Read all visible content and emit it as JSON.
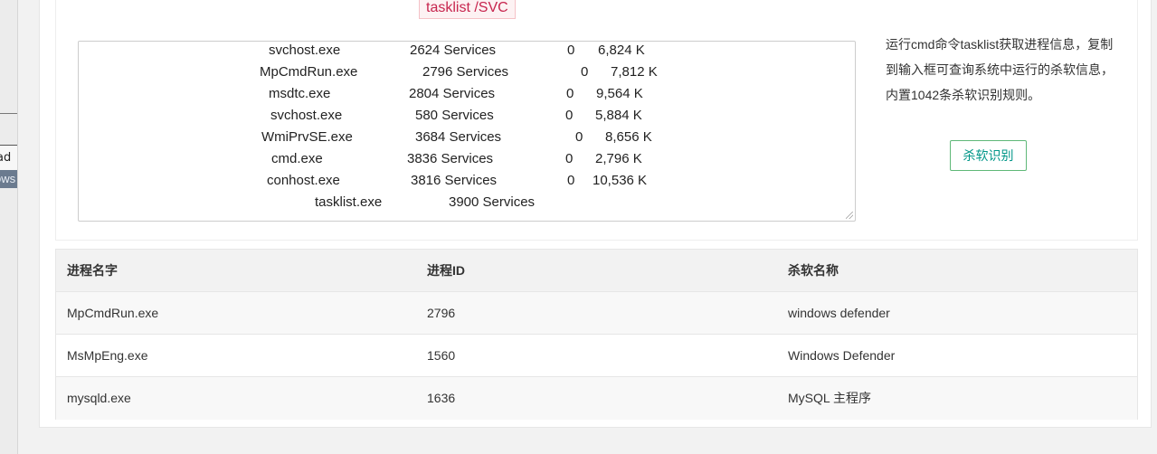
{
  "background_window": {
    "fragment_line1": "ad",
    "fragment_line2": "ows"
  },
  "command": "tasklist /SVC",
  "textarea_lines": [
    {
      "name": "svchost.exe",
      "pid": "2624 Services",
      "session": "0",
      "mem": "6,824 K"
    },
    {
      "name": "MpCmdRun.exe",
      "pid": "2796 Services",
      "session": "0",
      "mem": "7,812 K"
    },
    {
      "name": "msdtc.exe",
      "pid": "2804 Services",
      "session": "0",
      "mem": "9,564 K"
    },
    {
      "name": "svchost.exe",
      "pid": "580 Services",
      "session": "0",
      "mem": "5,884 K"
    },
    {
      "name": "WmiPrvSE.exe",
      "pid": "3684 Services",
      "session": "0",
      "mem": "8,656 K"
    },
    {
      "name": "cmd.exe",
      "pid": "3836 Services",
      "session": "0",
      "mem": "2,796 K"
    },
    {
      "name": "conhost.exe",
      "pid": "3816 Services",
      "session": "0",
      "mem": "10,536 K"
    },
    {
      "name": "tasklist.exe",
      "pid": "3900 Services",
      "session": "",
      "mem": ""
    }
  ],
  "description": "运行cmd命令tasklist获取进程信息，复制到输入框可查询系统中运行的杀软信息，内置1042条杀软识别规则。",
  "scan_button_label": "杀软识别",
  "table": {
    "headers": [
      "进程名字",
      "进程ID",
      "杀软名称"
    ],
    "rows": [
      [
        "MpCmdRun.exe",
        "2796",
        "windows defender"
      ],
      [
        "MsMpEng.exe",
        "1560",
        "Windows Defender"
      ],
      [
        "mysqld.exe",
        "1636",
        "MySQL 主程序"
      ]
    ]
  }
}
